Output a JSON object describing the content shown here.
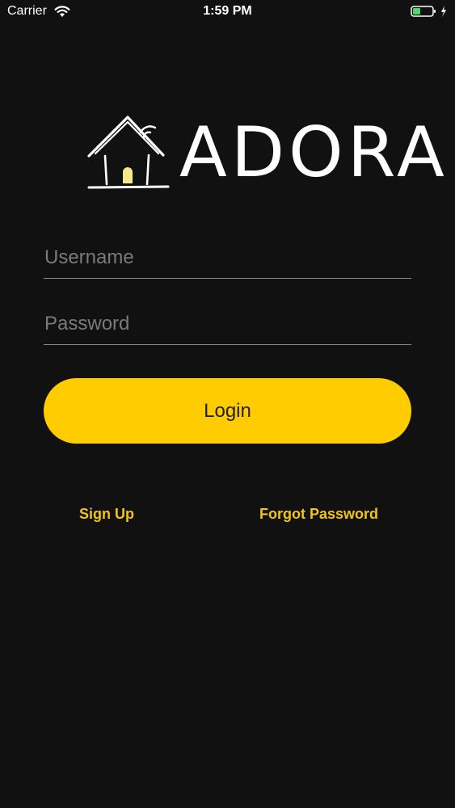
{
  "status_bar": {
    "carrier": "Carrier",
    "time": "1:59 PM",
    "wifi_icon": "wifi-icon",
    "battery_icon": "battery-charging-icon"
  },
  "logo": {
    "icon": "house-wifi-logo-icon",
    "wordmark": "ADORA"
  },
  "form": {
    "username": {
      "placeholder": "Username",
      "value": ""
    },
    "password": {
      "placeholder": "Password",
      "value": ""
    },
    "login_label": "Login"
  },
  "links": {
    "sign_up": "Sign Up",
    "forgot_password": "Forgot Password"
  },
  "colors": {
    "background": "#111111",
    "accent": "#FFCC00",
    "link": "#F2C418",
    "battery_fill": "#4CD964"
  }
}
